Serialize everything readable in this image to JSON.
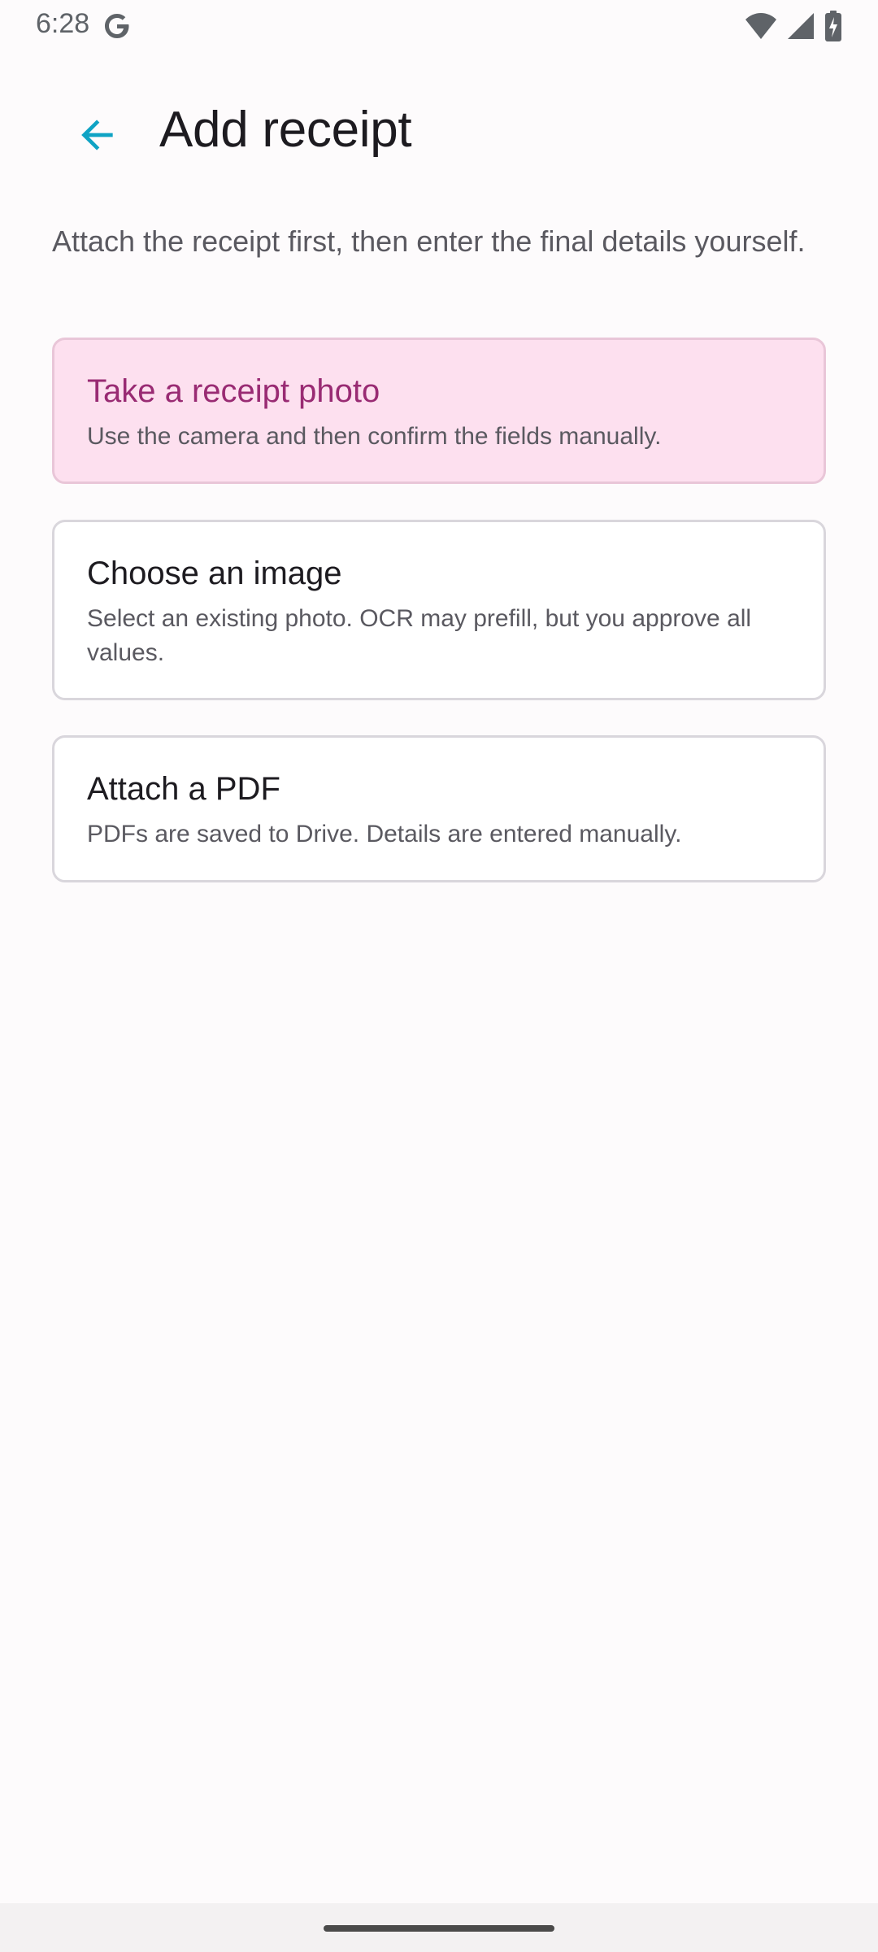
{
  "status_bar": {
    "time": "6:28",
    "icons": [
      "google-g-icon",
      "wifi-icon",
      "signal-icon",
      "battery-charging-icon"
    ]
  },
  "app_bar": {
    "title": "Add receipt",
    "back_icon": "back-arrow-icon",
    "accent_color": "#0fa3c4"
  },
  "intro": "Attach the receipt first, then enter the final details yourself.",
  "options": [
    {
      "title": "Take a receipt photo",
      "description": "Use the camera and then confirm the fields manually.",
      "selected": true
    },
    {
      "title": "Choose an image",
      "description": "Select an existing photo. OCR may prefill, but you approve all values.",
      "selected": false
    },
    {
      "title": "Attach a PDF",
      "description": "PDFs are saved to Drive. Details are entered manually.",
      "selected": false
    }
  ],
  "colors": {
    "selected_card_bg": "#fde0ef",
    "selected_title": "#992b73",
    "card_border": "#d9d6dc"
  }
}
